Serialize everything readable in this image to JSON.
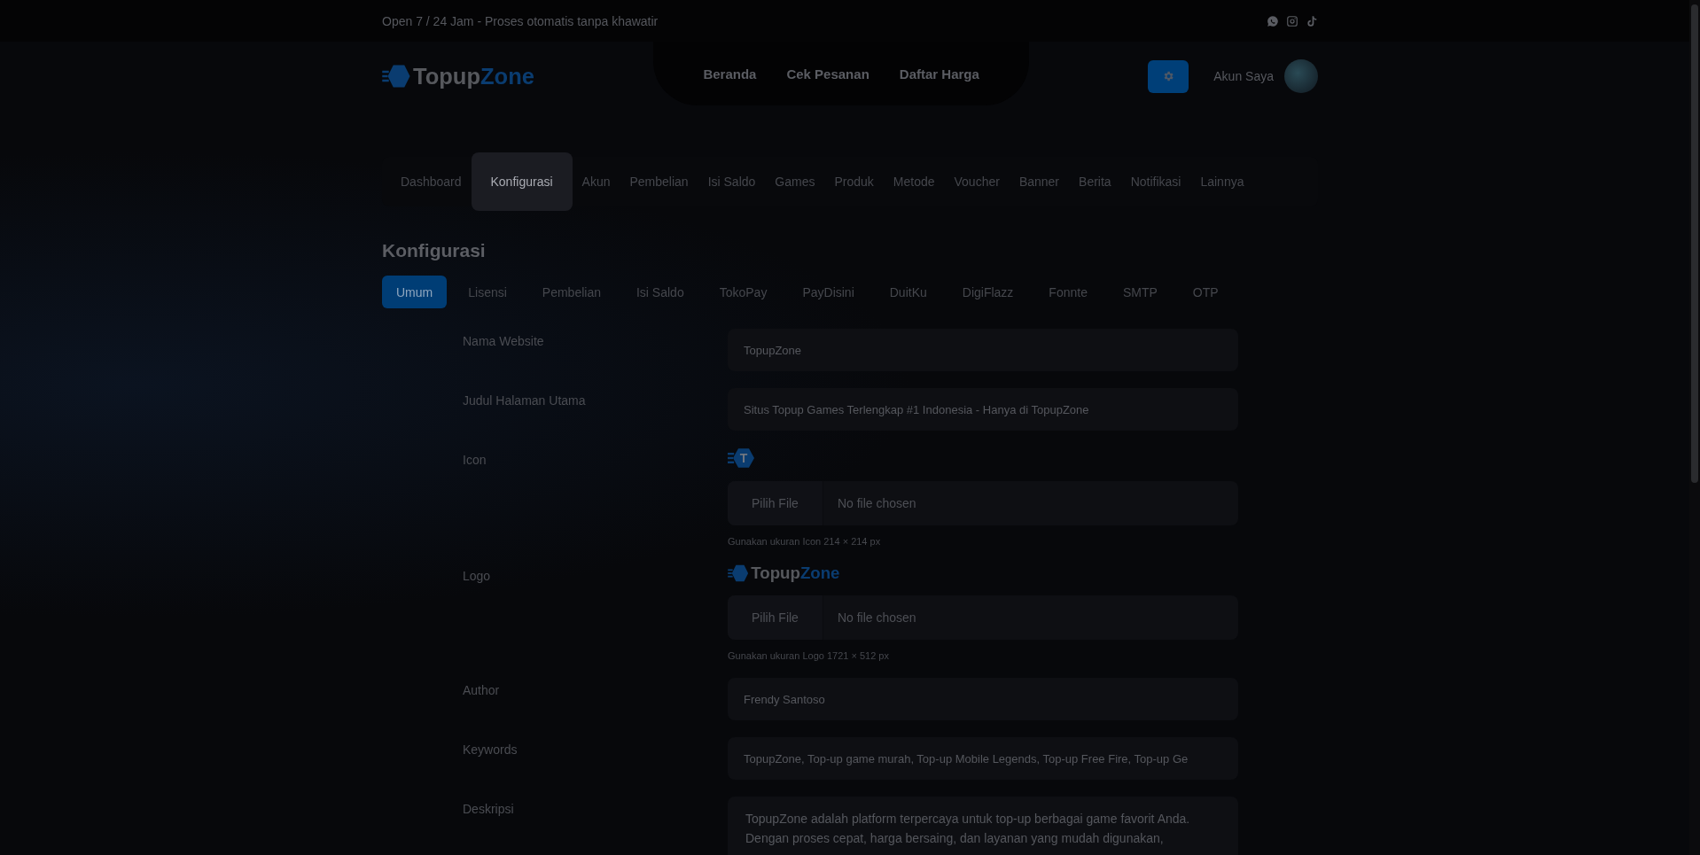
{
  "topbar": {
    "text": "Open 7 / 24 Jam - Proses otomatis tanpa khawatir"
  },
  "brand": {
    "first": "Topup",
    "second": "Zone"
  },
  "nav": [
    {
      "label": "Beranda"
    },
    {
      "label": "Cek Pesanan"
    },
    {
      "label": "Daftar Harga"
    }
  ],
  "account": {
    "label": "Akun Saya"
  },
  "admin_nav": [
    {
      "label": "Dashboard",
      "selected": false
    },
    {
      "label": "Konfigurasi",
      "selected": true
    },
    {
      "label": "Akun",
      "selected": false
    },
    {
      "label": "Pembelian",
      "selected": false
    },
    {
      "label": "Isi Saldo",
      "selected": false
    },
    {
      "label": "Games",
      "selected": false
    },
    {
      "label": "Produk",
      "selected": false
    },
    {
      "label": "Metode",
      "selected": false
    },
    {
      "label": "Voucher",
      "selected": false
    },
    {
      "label": "Banner",
      "selected": false
    },
    {
      "label": "Berita",
      "selected": false
    },
    {
      "label": "Notifikasi",
      "selected": false
    },
    {
      "label": "Lainnya",
      "selected": false
    }
  ],
  "page_title": "Konfigurasi",
  "tabs": [
    {
      "label": "Umum",
      "selected": true
    },
    {
      "label": "Lisensi",
      "selected": false
    },
    {
      "label": "Pembelian",
      "selected": false
    },
    {
      "label": "Isi Saldo",
      "selected": false
    },
    {
      "label": "TokoPay",
      "selected": false
    },
    {
      "label": "PayDisini",
      "selected": false
    },
    {
      "label": "DuitKu",
      "selected": false
    },
    {
      "label": "DigiFlazz",
      "selected": false
    },
    {
      "label": "Fonnte",
      "selected": false
    },
    {
      "label": "SMTP",
      "selected": false
    },
    {
      "label": "OTP",
      "selected": false
    }
  ],
  "fields": [
    {
      "kind": "text",
      "label": "Nama Website",
      "value": "TopupZone"
    },
    {
      "kind": "text",
      "label": "Judul Halaman Utama",
      "value": "Situs Topup Games Terlengkap #1 Indonesia - Hanya di TopupZone"
    },
    {
      "kind": "file",
      "label": "Icon",
      "preview": {
        "kind": "icon",
        "text": "T"
      },
      "button": "Pilih File",
      "status": "No file chosen",
      "hint": "Gunakan ukuran Icon 214 × 214 px"
    },
    {
      "kind": "file",
      "label": "Logo",
      "preview": {
        "kind": "logo",
        "first": "Topup",
        "second": "Zone"
      },
      "button": "Pilih File",
      "status": "No file chosen",
      "hint": "Gunakan ukuran Logo 1721 × 512 px"
    },
    {
      "kind": "text",
      "label": "Author",
      "value": "Frendy Santoso"
    },
    {
      "kind": "text",
      "label": "Keywords",
      "value": "TopupZone, Top-up game murah, Top-up Mobile Legends, Top-up Free Fire, Top-up Ge"
    },
    {
      "kind": "textarea",
      "label": "Deskripsi",
      "lines": [
        "TopupZone adalah platform terpercaya untuk top-up berbagai game favorit Anda.",
        "Dengan proses cepat, harga bersaing, dan layanan yang mudah digunakan,"
      ]
    }
  ]
}
